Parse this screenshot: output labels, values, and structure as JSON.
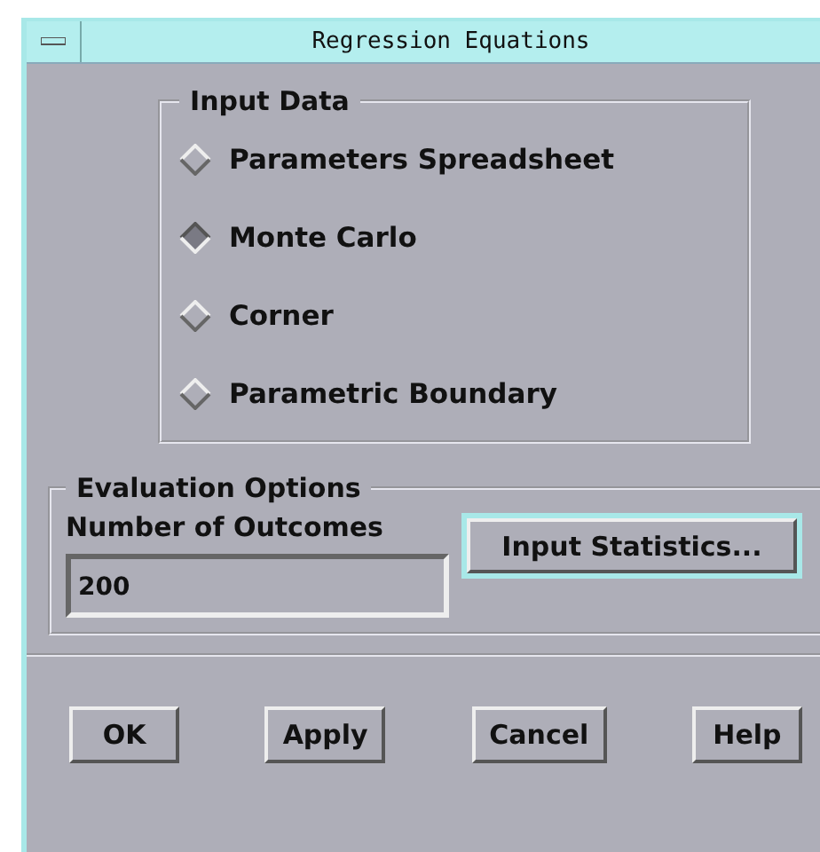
{
  "window": {
    "title": "Regression Equations"
  },
  "input_data": {
    "title": "Input Data",
    "options": [
      {
        "label": "Parameters Spreadsheet",
        "selected": false
      },
      {
        "label": "Monte Carlo",
        "selected": true
      },
      {
        "label": "Corner",
        "selected": false
      },
      {
        "label": "Parametric Boundary",
        "selected": false
      }
    ]
  },
  "evaluation_options": {
    "title": "Evaluation Options",
    "outcomes_label": "Number of Outcomes",
    "outcomes_value": "200",
    "statistics_button": {
      "label": "Input Statistics...",
      "default": true
    }
  },
  "buttons": [
    "OK",
    "Apply",
    "Cancel",
    "Help"
  ]
}
